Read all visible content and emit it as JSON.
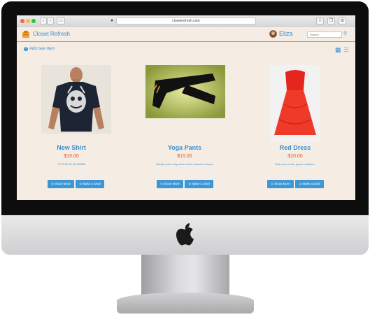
{
  "browser": {
    "url": "closetrefresh.com",
    "back": "‹",
    "forward": "›"
  },
  "app": {
    "brand": "Closet Refresh",
    "username": "Eliza",
    "search_placeholder": "Search",
    "add_new_item": "Add new item"
  },
  "products": [
    {
      "title": "New Shirt",
      "price": "$15.00",
      "description": "YO THIS IS DA BOMB",
      "show_more": "Show More",
      "make_deal": "Make a Deal"
    },
    {
      "title": "Yoga Pants",
      "price": "$15.00",
      "description": "Gently used, only wore to two classes in them.",
      "show_more": "Show More",
      "make_deal": "Make a Deal"
    },
    {
      "title": "Red Dress",
      "price": "$20.00",
      "description": "Only worn once, great condition.",
      "show_more": "Show More",
      "make_deal": "Make a Deal"
    }
  ],
  "icons": {
    "search": "search-icon",
    "grid_view": "grid-view-icon",
    "list_view": "list-view-icon",
    "logo": "hanger-logo-icon"
  },
  "colors": {
    "accent": "#3a8fd0",
    "price": "#e0552e",
    "background": "#f5ede4",
    "button": "#3c97d6"
  }
}
